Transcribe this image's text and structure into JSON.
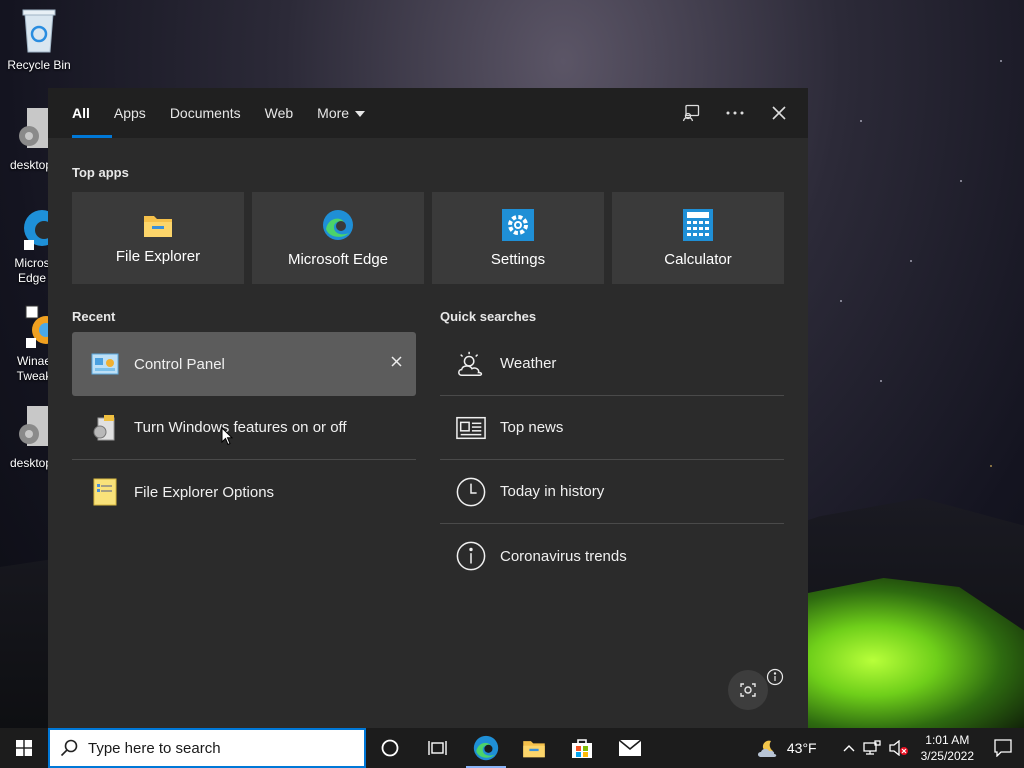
{
  "desktop": {
    "icons": [
      {
        "label": "Recycle Bin"
      },
      {
        "label": "desktop"
      },
      {
        "label": "Micros Edge"
      },
      {
        "label": "Winae Tweak"
      },
      {
        "label": "desktop"
      }
    ]
  },
  "search_panel": {
    "tabs": [
      {
        "label": "All"
      },
      {
        "label": "Apps"
      },
      {
        "label": "Documents"
      },
      {
        "label": "Web"
      },
      {
        "label": "More"
      }
    ],
    "top_apps_label": "Top apps",
    "top_apps": [
      {
        "label": "File Explorer",
        "icon": "folder-icon"
      },
      {
        "label": "Microsoft Edge",
        "icon": "edge-icon"
      },
      {
        "label": "Settings",
        "icon": "gear-icon"
      },
      {
        "label": "Calculator",
        "icon": "calculator-icon"
      }
    ],
    "recent_label": "Recent",
    "recent": [
      {
        "label": "Control Panel",
        "icon": "control-panel-icon"
      },
      {
        "label": "Turn Windows features on or off",
        "icon": "windows-features-icon"
      },
      {
        "label": "File Explorer Options",
        "icon": "folder-options-icon"
      }
    ],
    "quick_searches_label": "Quick searches",
    "quick_searches": [
      {
        "label": "Weather",
        "icon": "weather-icon"
      },
      {
        "label": "Top news",
        "icon": "news-icon"
      },
      {
        "label": "Today in history",
        "icon": "clock-icon"
      },
      {
        "label": "Coronavirus trends",
        "icon": "info-icon"
      }
    ]
  },
  "taskbar": {
    "search_placeholder": "Type here to search",
    "weather_temp": "43°F",
    "time": "1:01 AM",
    "date": "3/25/2022"
  },
  "colors": {
    "accent": "#0078d7",
    "panel_bg": "#2b2b2b",
    "tabbar_bg": "#202020",
    "tile_bg": "#3a3a3a",
    "selected_row_bg": "#5c5c5c"
  }
}
